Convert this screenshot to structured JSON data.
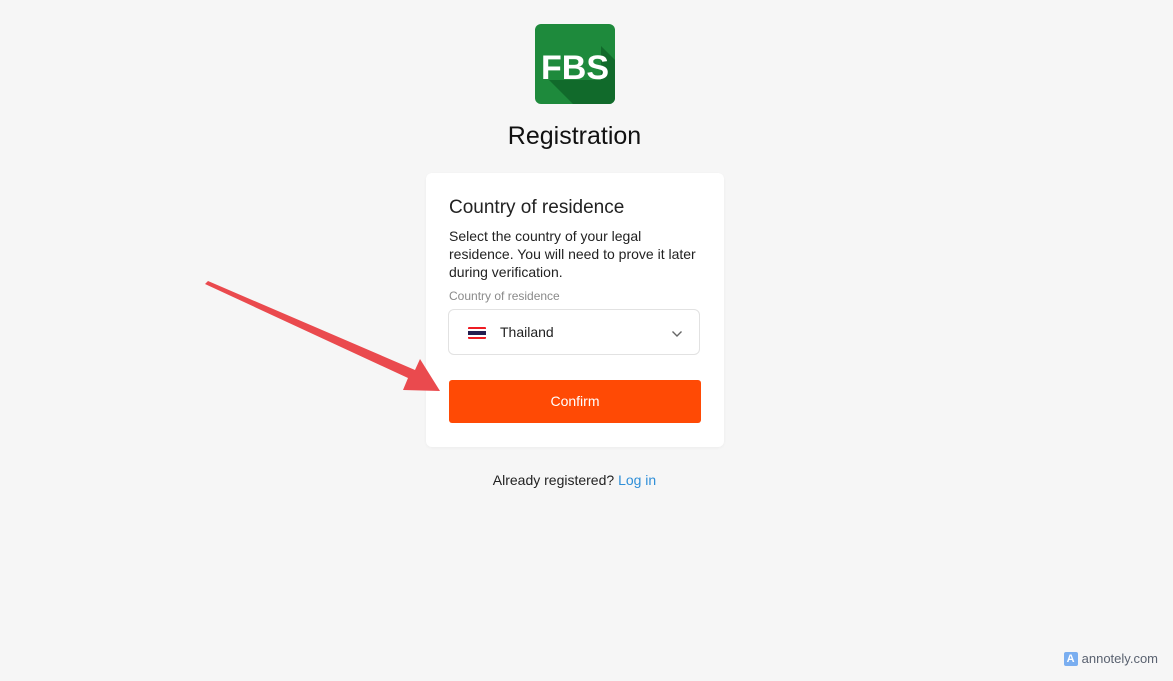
{
  "brand": {
    "logo_text": "FBS",
    "logo_color": "#1e8a3c",
    "logo_shadow_color": "#116a2b"
  },
  "page": {
    "title": "Registration"
  },
  "card": {
    "heading": "Country of residence",
    "description": "Select the country of your legal residence. You will need to prove it later during verification.",
    "field_label": "Country of residence",
    "selected_country": "Thailand",
    "selected_flag_icon": "thailand-flag-icon",
    "dropdown_icon": "chevron-down-icon",
    "confirm_label": "Confirm",
    "confirm_color": "#ff4a05"
  },
  "footer": {
    "prompt": "Already registered?",
    "login_label": "Log in",
    "link_color": "#2f8fd8"
  },
  "annotation": {
    "arrow_color": "#ea4a4e",
    "arrow_icon": "pointer-arrow-icon"
  },
  "watermark": {
    "text": "annotely.com",
    "icon": "annotely-logo-icon"
  }
}
